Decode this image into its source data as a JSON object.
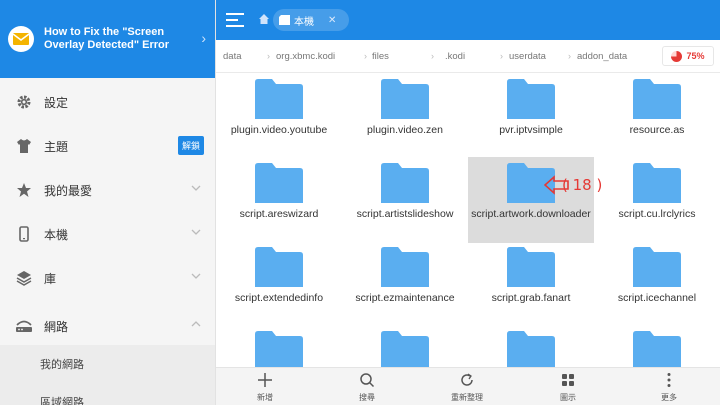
{
  "colors": {
    "accent": "#1e88e5",
    "folder": "#5aaef0",
    "storage_alert": "#e53935",
    "annotation": "#e53935"
  },
  "sidebar": {
    "header_title": "How to Fix the \"Screen Overlay Detected\" Error",
    "header_icon": "mail-icon",
    "items": [
      {
        "label": "設定",
        "icon": "gear-icon"
      },
      {
        "label": "主題",
        "icon": "shirt-icon",
        "badge": "解鎖"
      },
      {
        "label": "我的最愛",
        "icon": "star-icon"
      },
      {
        "label": "本機",
        "icon": "phone-icon"
      },
      {
        "label": "庫",
        "icon": "layers-icon"
      },
      {
        "label": "網路",
        "icon": "network-icon"
      }
    ],
    "subitems": [
      "我的網路",
      "區域網路"
    ]
  },
  "topbar": {
    "device_tab": "本機"
  },
  "breadcrumb": [
    "data",
    "org.xbmc.kodi",
    "files",
    ".kodi",
    "userdata",
    "addon_data"
  ],
  "storage": {
    "percent": "75%",
    "fraction": 0.75
  },
  "folders": [
    "plugin.video.youtube",
    "plugin.video.zen",
    "pvr.iptvsimple",
    "resource.as",
    "script.areswizard",
    "script.artistslideshow",
    "script.artwork.downloader",
    "script.cu.lrclyrics",
    "script.extendedinfo",
    "script.ezmaintenance",
    "script.grab.fanart",
    "script.icechannel",
    "",
    "",
    "",
    ""
  ],
  "selected_folder": "script.artwork.downloader",
  "annotation": "( 18 )",
  "bottombar": [
    "新增",
    "搜尋",
    "重新整理",
    "圖示",
    "更多"
  ]
}
